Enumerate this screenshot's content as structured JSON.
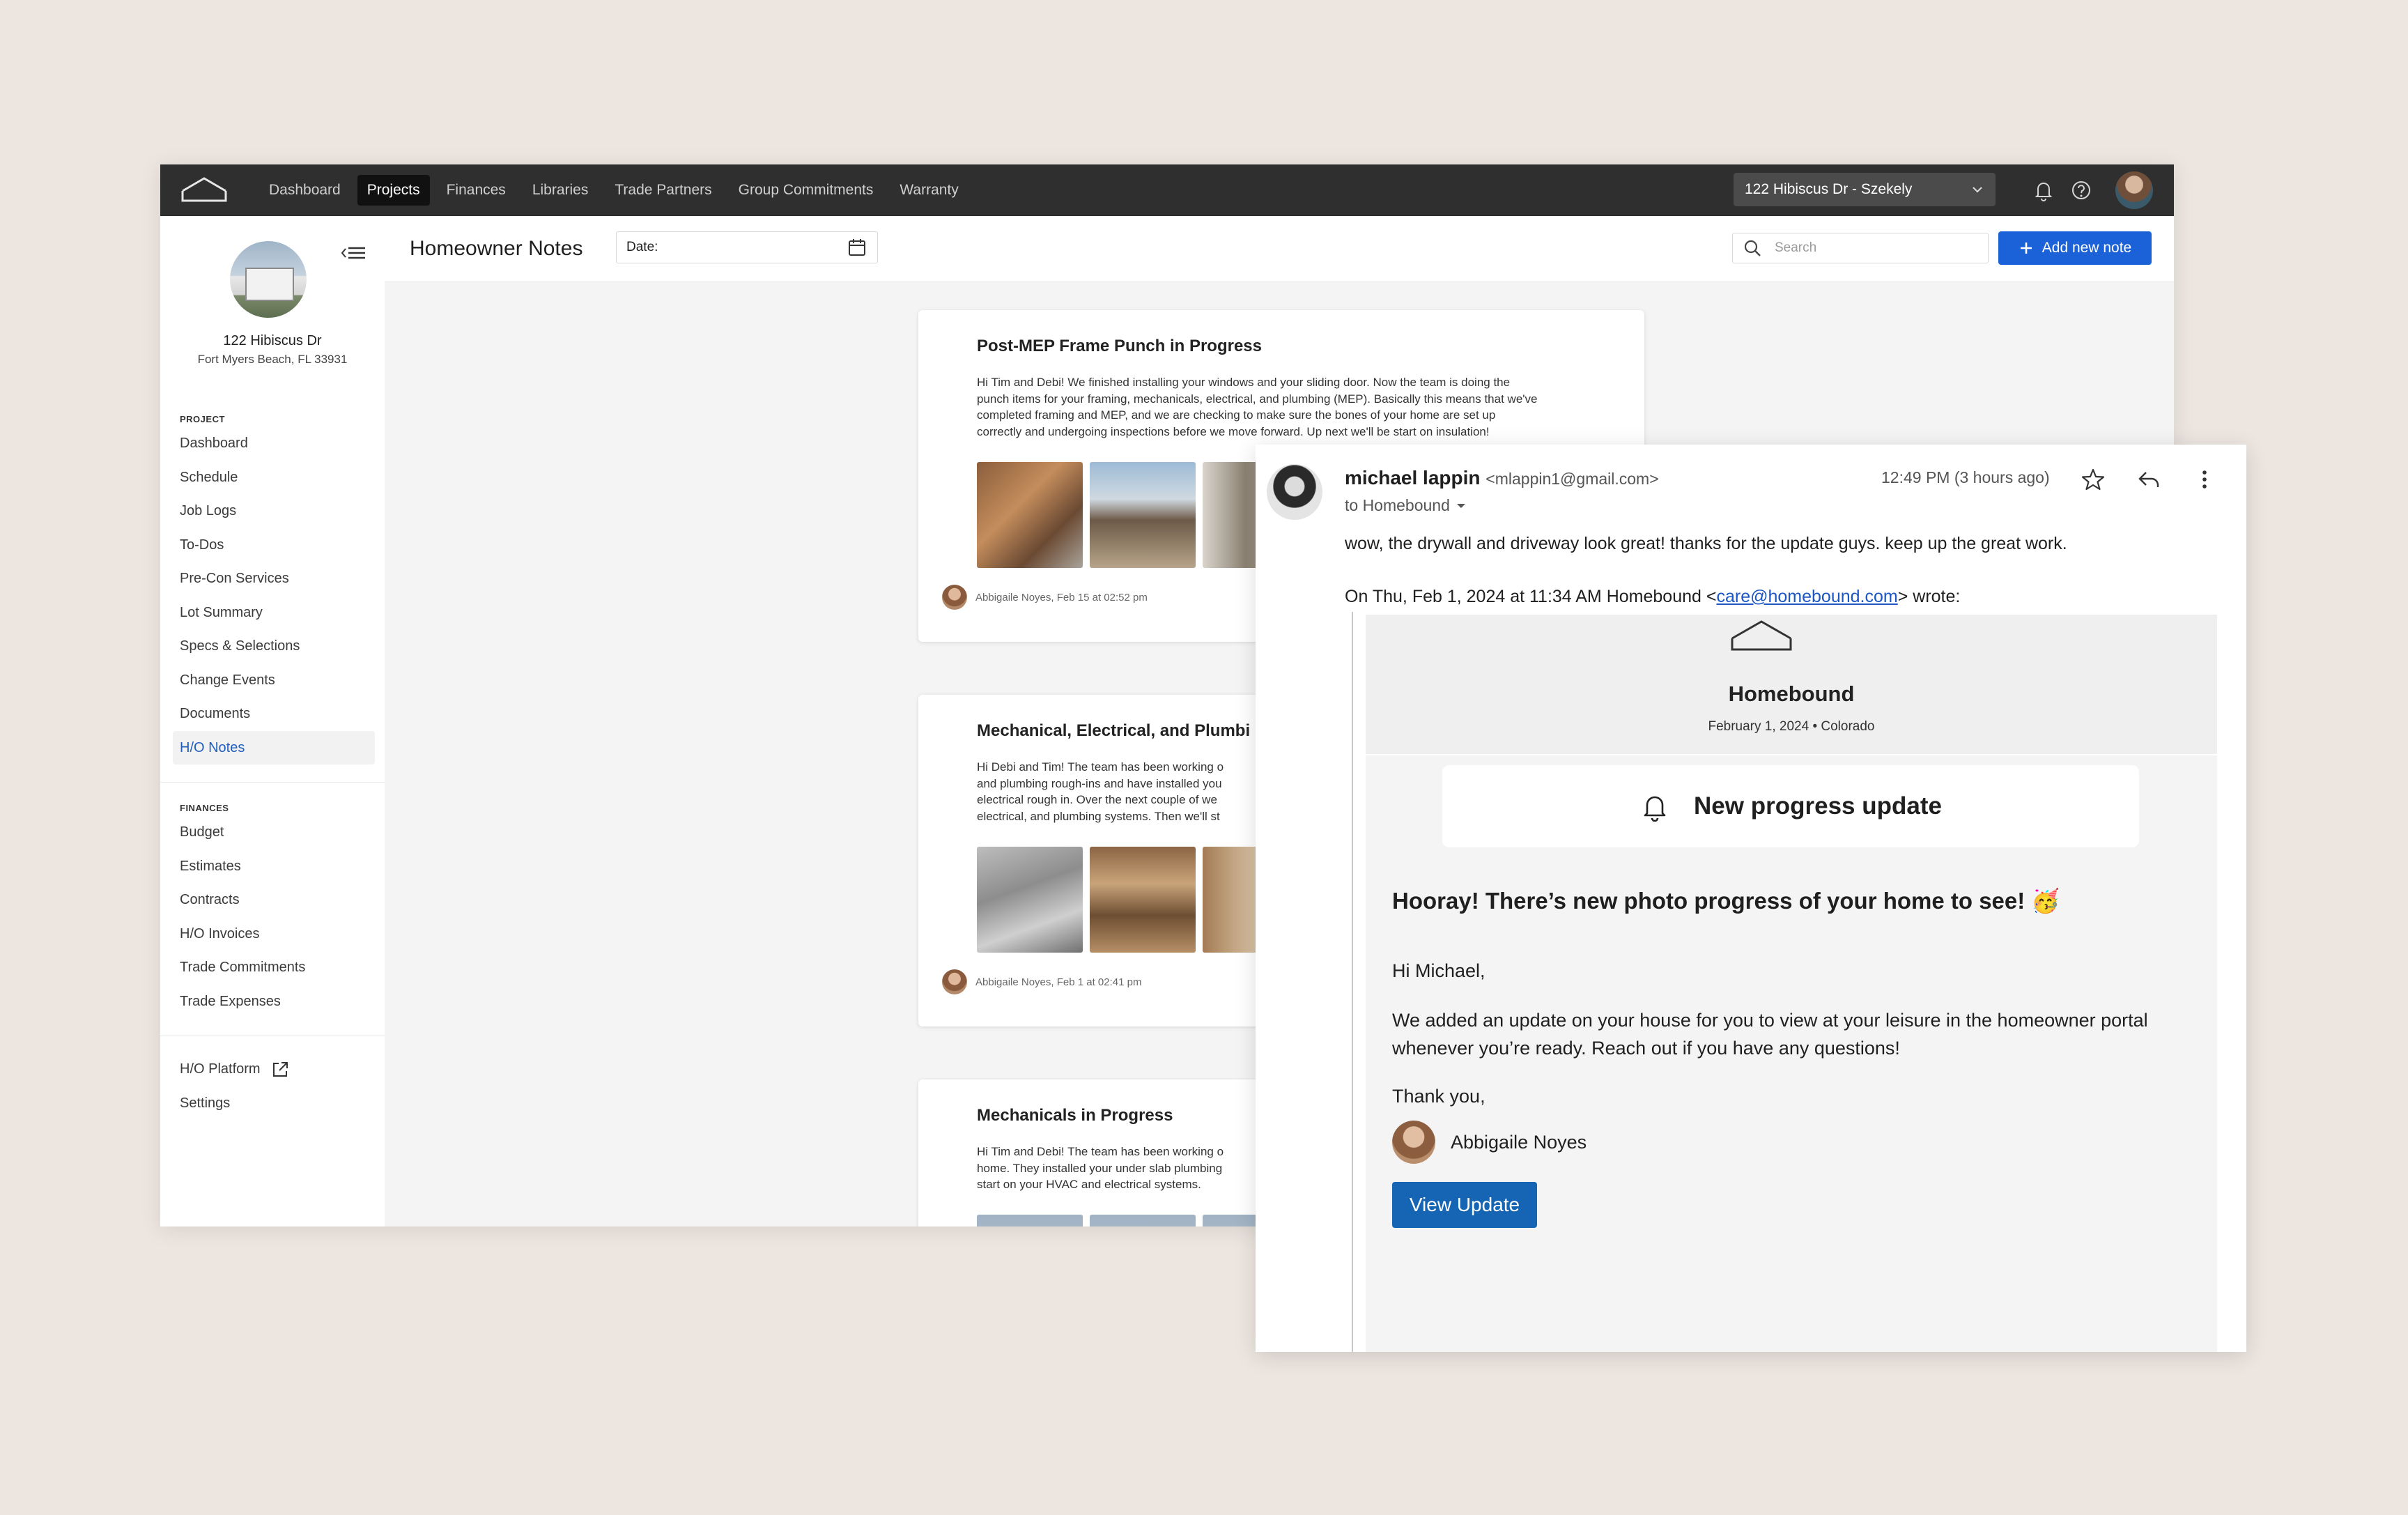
{
  "topnav": {
    "items": [
      "Dashboard",
      "Projects",
      "Finances",
      "Libraries",
      "Trade Partners",
      "Group Commitments",
      "Warranty"
    ],
    "active": "Projects",
    "project_selector": "122 Hibiscus Dr - Szekely"
  },
  "sidebar": {
    "property_name": "122 Hibiscus Dr",
    "property_address": "Fort Myers Beach, FL 33931",
    "project_heading": "PROJECT",
    "project_items": [
      "Dashboard",
      "Schedule",
      "Job Logs",
      "To-Dos",
      "Pre-Con Services",
      "Lot Summary",
      "Specs & Selections",
      "Change Events",
      "Documents",
      "H/O Notes"
    ],
    "active_item": "H/O Notes",
    "finances_heading": "FINANCES",
    "finance_items": [
      "Budget",
      "Estimates",
      "Contracts",
      "H/O Invoices",
      "Trade Commitments",
      "Trade Expenses"
    ],
    "footer_items": [
      "H/O Platform",
      "Settings"
    ]
  },
  "header": {
    "title": "Homeowner Notes",
    "date_label": "Date:",
    "search_placeholder": "Search",
    "add_button": "Add new note"
  },
  "notes": [
    {
      "title": "Post-MEP Frame Punch in Progress",
      "lines": [
        "Hi Tim and Debi! We finished installing your windows and your sliding door. Now the team is doing the",
        "punch items for your framing, mechanicals, electrical, and plumbing (MEP). Basically this means that we've",
        "completed framing and MEP, and we are checking to make sure the bones of your home are set up",
        "correctly and undergoing inspections before we move forward. Up next we'll be start on insulation!"
      ],
      "author": "Abbigaile Noyes, Feb 15 at 02:52 pm"
    },
    {
      "title": "Mechanical, Electrical, and Plumbi",
      "lines": [
        "Hi Debi and Tim! The team has been working o",
        "and plumbing rough-ins and have installed you",
        "electrical rough in. Over the next couple of we",
        "electrical, and plumbing systems. Then we'll st"
      ],
      "author": "Abbigaile Noyes, Feb 1 at 02:41 pm"
    },
    {
      "title": "Mechanicals in Progress",
      "lines": [
        "Hi Tim and Debi! The team has been working o",
        "home. They installed your under slab plumbing",
        "start on your HVAC and electrical systems."
      ],
      "author": ""
    }
  ],
  "email": {
    "sender_name": "michael lappin",
    "sender_address": "<mlappin1@gmail.com>",
    "to": "to Homebound",
    "time": "12:49 PM (3 hours ago)",
    "reply": "wow, the drywall and driveway look great! thanks for the update guys. keep up the great work.",
    "quote_prefix": "On Thu, Feb 1, 2024 at 11:34 AM Homebound <",
    "quote_email": "care@homebound.com",
    "quote_suffix": "> wrote:",
    "brand": "Homebound",
    "date_line": "February 1, 2024 • Colorado",
    "banner": "New progress update",
    "headline": "Hooray! There’s new photo progress of your home to see! 🥳",
    "greeting": "Hi Michael,",
    "message": "We added an update on your house for you to view at your leisure in the homeowner portal whenever you’re ready. Reach out if you have any questions!",
    "signoff": "Thank you,",
    "signature": "Abbigaile Noyes",
    "button": "View Update"
  },
  "colors": {
    "background": "#ede6e0",
    "topbar": "#2f2f2f",
    "primary_button": "#1b62d8",
    "active_link": "#1f5fbf",
    "email_button": "#1565b4"
  }
}
